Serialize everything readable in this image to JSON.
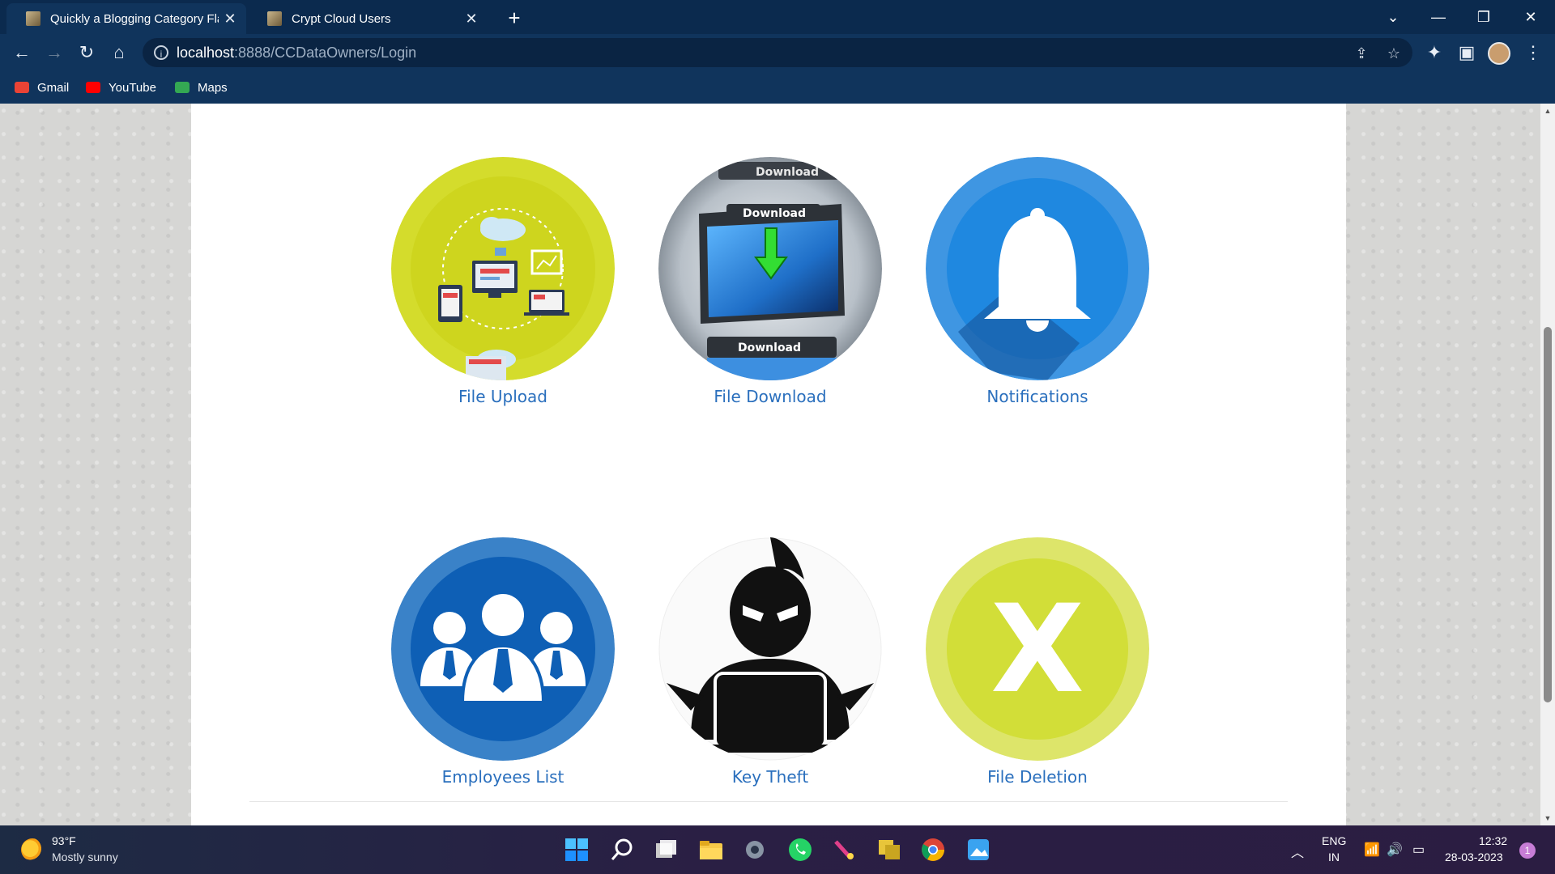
{
  "tabs": [
    {
      "title": "Quickly a Blogging Category Flat",
      "active": true
    },
    {
      "title": "Crypt Cloud Users",
      "active": false
    }
  ],
  "window_controls": {
    "minimize": "—",
    "restore": "❐",
    "close": "✕",
    "tab_search": "⌄",
    "new_tab": "+"
  },
  "address_bar": {
    "host": "localhost",
    "path": ":8888/CCDataOwners/Login"
  },
  "bookmarks": [
    {
      "label": "Gmail",
      "color": "#ea4335"
    },
    {
      "label": "YouTube",
      "color": "#ff0000"
    },
    {
      "label": "Maps",
      "color": "#34a853"
    }
  ],
  "page": {
    "cards": [
      {
        "label": "File Upload",
        "icon": "file-upload-icon",
        "color": "#d4dc2c"
      },
      {
        "label": "File Download",
        "icon": "file-download-icon",
        "color": "#b9c2cc"
      },
      {
        "label": "Notifications",
        "icon": "bell-icon",
        "color": "#1f88e0"
      },
      {
        "label": "Employees List",
        "icon": "employees-icon",
        "color": "#0e5fb5"
      },
      {
        "label": "Key Theft",
        "icon": "hacker-icon",
        "color": "#111111"
      },
      {
        "label": "File Deletion",
        "icon": "delete-x-icon",
        "color": "#d4e03c"
      }
    ],
    "download_text": "Download",
    "deletion_glyph": "X"
  },
  "taskbar": {
    "weather_temp": "93°F",
    "weather_desc": "Mostly sunny",
    "language": "ENG",
    "region": "IN",
    "time": "12:32",
    "date": "28-03-2023",
    "notification_count": "1"
  }
}
